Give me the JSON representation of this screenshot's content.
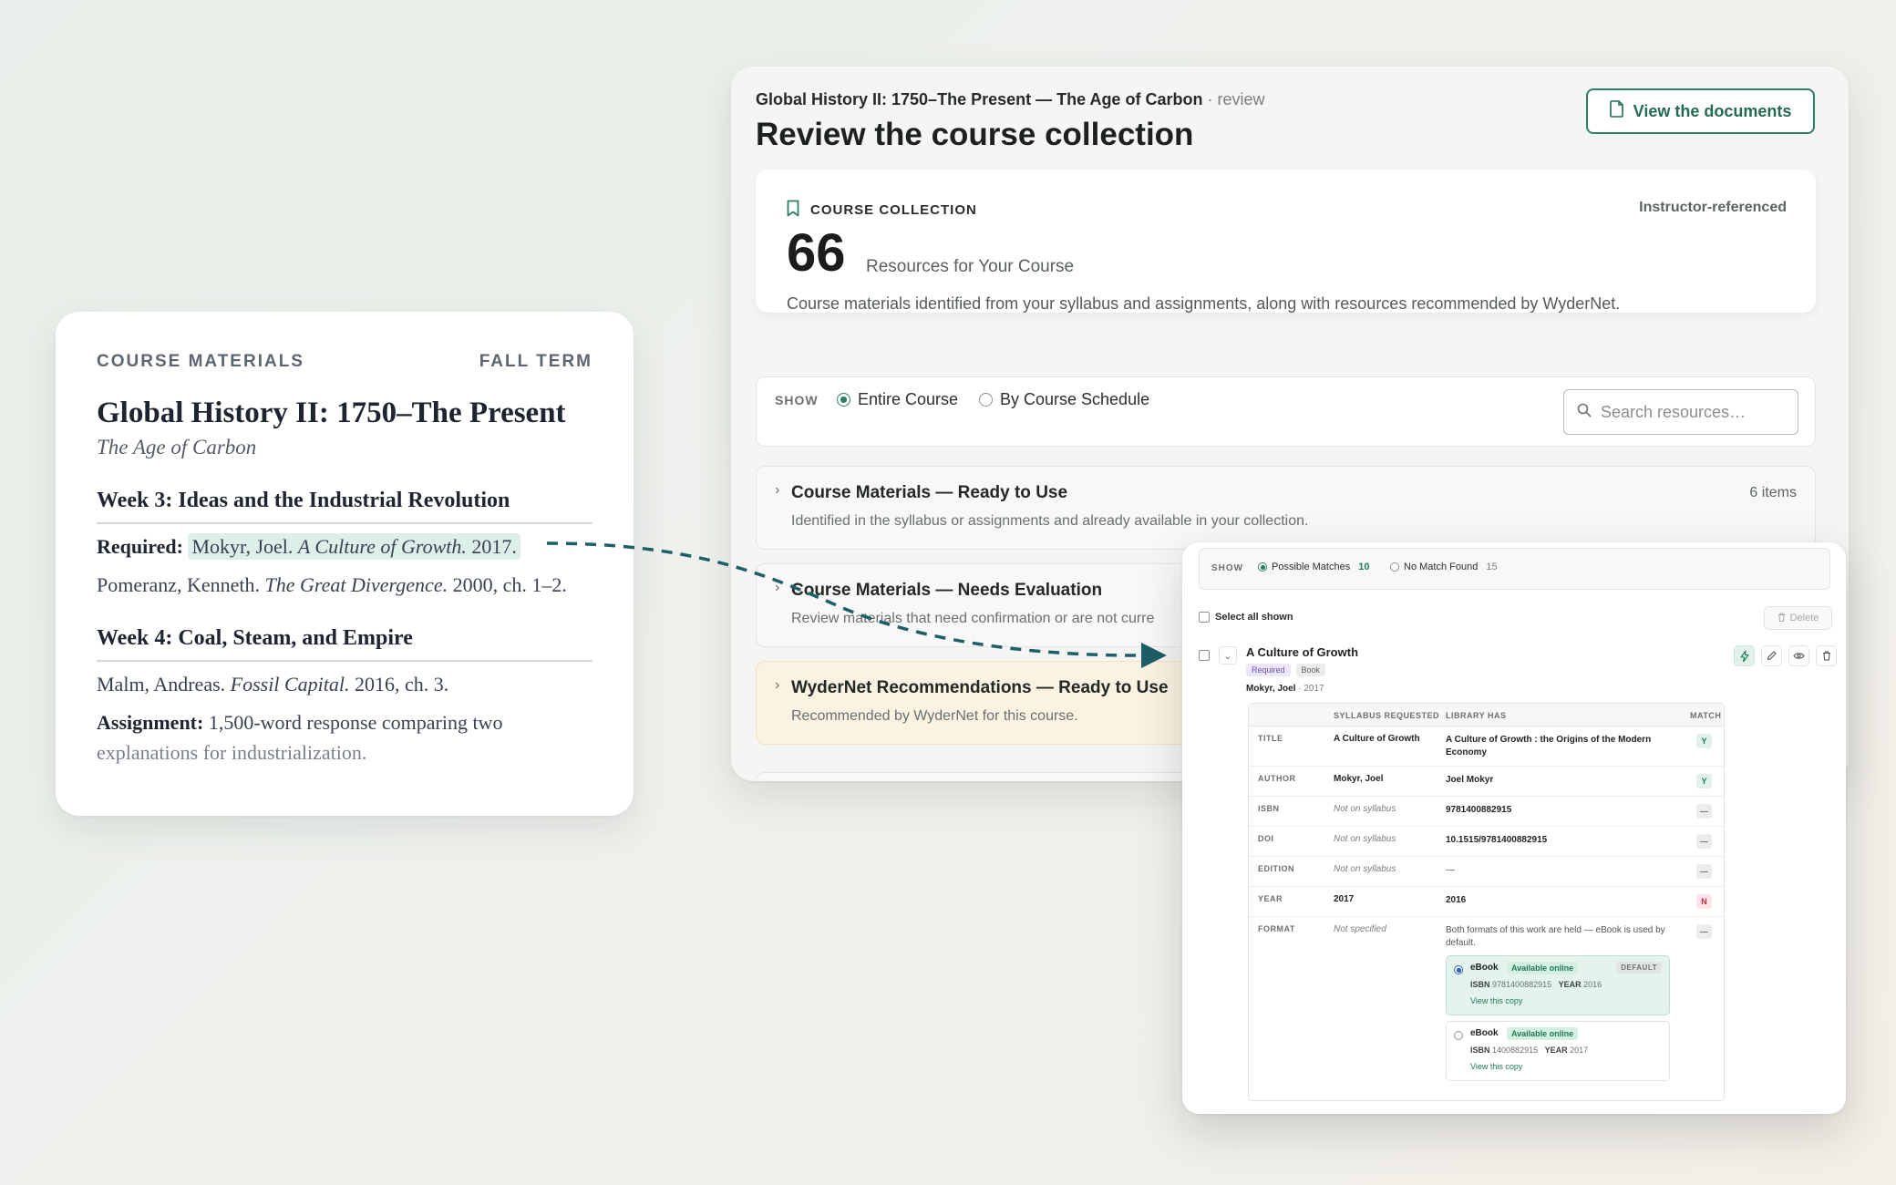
{
  "syllabus": {
    "label": "COURSE MATERIALS",
    "term": "FALL TERM",
    "title": "Global History II: 1750–The Present",
    "subtitle": "The Age of Carbon",
    "week3": {
      "heading": "Week 3: Ideas and the Industrial Revolution",
      "required_label": "Required:",
      "required_author": "Mokyr, Joel.",
      "required_title": "A Culture of Growth.",
      "required_year": "2017.",
      "line2_author": "Pomeranz, Kenneth.",
      "line2_title": "The Great Divergence.",
      "line2_rest": "2000, ch. 1–2."
    },
    "week4": {
      "heading": "Week 4: Coal, Steam, and Empire",
      "line1_author": "Malm, Andreas.",
      "line1_title": "Fossil Capital.",
      "line1_rest": "2016, ch. 3.",
      "assignment_label": "Assignment:",
      "assignment_text_a": "1,500-word response comparing two",
      "assignment_text_b": "explanations for industrialization."
    }
  },
  "main": {
    "breadcrumb": "Global History II: 1750–The Present — The Age of Carbon",
    "breadcrumb_suffix": "· review",
    "title": "Review the course collection",
    "view_docs_label": "View the documents",
    "collection": {
      "label": "COURSE COLLECTION",
      "right_label": "Instructor-referenced",
      "count": "66",
      "count_label": "Resources for Your Course",
      "description": "Course materials identified from your syllabus and assignments, along with resources recommended by WyderNet."
    },
    "filter": {
      "show_label": "SHOW",
      "option_entire": "Entire Course",
      "option_schedule": "By Course Schedule",
      "search_placeholder": "Search resources…"
    },
    "sections": [
      {
        "title": "Course Materials — Ready to Use",
        "desc": "Identified in the syllabus or assignments and already available in your collection.",
        "count": "6 items"
      },
      {
        "title": "Course Materials — Needs Evaluation",
        "desc": "Review materials that need confirmation or are not curre"
      },
      {
        "title": "WyderNet Recommendations — Ready to Use",
        "desc": "Recommended by WyderNet for this course."
      }
    ]
  },
  "detail": {
    "show_label": "SHOW",
    "possible_label": "Possible Matches",
    "possible_count": "10",
    "nomatch_label": "No Match Found",
    "nomatch_count": "15",
    "select_all": "Select all shown",
    "delete_label": "Delete",
    "item": {
      "title": "A Culture of Growth",
      "tag_required": "Required",
      "tag_type": "Book",
      "author": "Mokyr, Joel",
      "year": "· 2017"
    },
    "table": {
      "headers": [
        "SYLLABUS REQUESTED",
        "LIBRARY HAS",
        "MATCH"
      ],
      "rows": [
        {
          "field": "TITLE",
          "requested": "A Culture of Growth",
          "library": "A Culture of Growth : the Origins of the Modern Economy",
          "match": "Y"
        },
        {
          "field": "AUTHOR",
          "requested": "Mokyr, Joel",
          "library": "Joel Mokyr",
          "match": "Y"
        },
        {
          "field": "ISBN",
          "requested": "Not on syllabus",
          "library": "9781400882915",
          "match": "—"
        },
        {
          "field": "DOI",
          "requested": "Not on syllabus",
          "library": "10.1515/9781400882915",
          "match": "—"
        },
        {
          "field": "EDITION",
          "requested": "Not on syllabus",
          "library": "—",
          "match": "—"
        },
        {
          "field": "YEAR",
          "requested": "2017",
          "library": "2016",
          "match": "N"
        },
        {
          "field": "FORMAT",
          "requested": "Not specified",
          "library": "Both formats of this work are held — eBook is used by default.",
          "match": "—"
        }
      ],
      "options": [
        {
          "format": "eBook",
          "availability": "Available online",
          "default": "DEFAULT",
          "isbn_label": "ISBN",
          "isbn": "9781400882915",
          "year_label": "YEAR",
          "year": "2016",
          "view": "View this copy"
        },
        {
          "format": "eBook",
          "availability": "Available online",
          "isbn_label": "ISBN",
          "isbn": "1400882915",
          "year_label": "YEAR",
          "year": "2017",
          "view": "View this copy"
        }
      ]
    }
  },
  "colors": {
    "accent": "#2e7f61",
    "arrow": "#1d5f66",
    "highlight": "#dcefe9",
    "recommendation_bg": "#fbf2e2"
  }
}
